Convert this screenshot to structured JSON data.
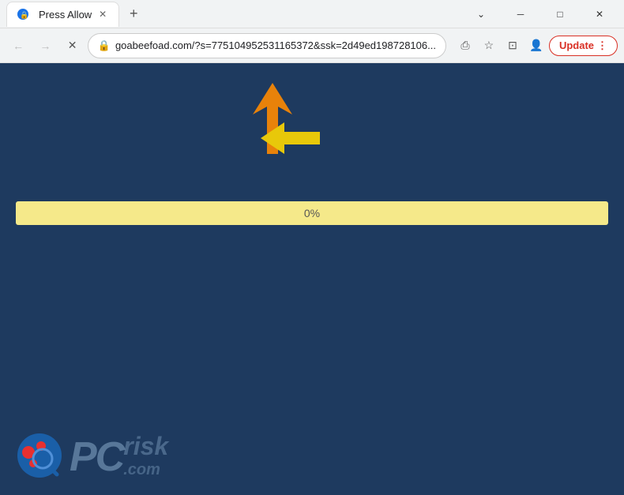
{
  "browser": {
    "title": "Press Allow",
    "url": "goabeefoad.com/?s=775104952531165372&ssk=2d49ed198728106...",
    "url_full": "goabeefoad.com/?s=775104952531165372&ssk=2d49ed198728106...",
    "tab_label": "Press Allow",
    "favicon": "🔒",
    "update_btn": "Update",
    "new_tab_btn": "+",
    "nav": {
      "back": "←",
      "forward": "→",
      "reload": "✕"
    },
    "window_controls": {
      "minimize": "─",
      "maximize": "□",
      "close": "✕"
    }
  },
  "content": {
    "progress_percent": "0%",
    "progress_value": 0,
    "arrows": {
      "orange": "orange arrow pointing up-right",
      "yellow": "yellow arrow pointing left"
    }
  },
  "pcrisk": {
    "logo_text": "PC",
    "risk_text": "risk",
    "domain": ".com"
  },
  "colors": {
    "background": "#1e3a5f",
    "progress_bg": "#f5e98a",
    "orange_arrow": "#e8820a",
    "yellow_arrow": "#e8c80a",
    "update_border": "#d93025",
    "update_text": "#d93025"
  }
}
